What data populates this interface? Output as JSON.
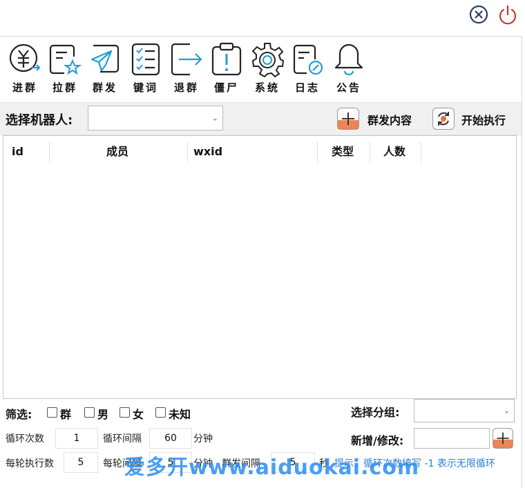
{
  "toolbar": {
    "items": [
      {
        "label": "进群",
        "icon": "yuan-group-icon"
      },
      {
        "label": "拉群",
        "icon": "document-star-icon"
      },
      {
        "label": "群发",
        "icon": "paper-plane-icon"
      },
      {
        "label": "键词",
        "icon": "checklist-icon"
      },
      {
        "label": "退群",
        "icon": "exit-arrow-icon"
      },
      {
        "label": "僵尸",
        "icon": "clipboard-alert-icon"
      },
      {
        "label": "系统",
        "icon": "gear-icon"
      },
      {
        "label": "日志",
        "icon": "document-edit-icon"
      },
      {
        "label": "公告",
        "icon": "bell-icon"
      }
    ]
  },
  "robot": {
    "label": "选择机器人:",
    "selected": "",
    "broadcast_label": "群发内容",
    "start_label": "开始执行"
  },
  "table": {
    "columns": [
      "id",
      "成员",
      "wxid",
      "类型",
      "人数"
    ],
    "rows": []
  },
  "filter": {
    "label": "筛选:",
    "options": [
      "群",
      "男",
      "女",
      "未知"
    ]
  },
  "group": {
    "select_label": "选择分组:",
    "selected": "",
    "add_label": "新增/修改:",
    "add_value": ""
  },
  "settings": {
    "loop_count_label": "循环次数",
    "loop_count": "1",
    "loop_interval_label": "循环间隔",
    "loop_interval": "60",
    "minute_unit": "分钟",
    "per_round_label": "每轮执行数",
    "per_round": "5",
    "round_interval_label": "每轮间隔",
    "round_interval": "5",
    "send_interval_label": "群发间隔",
    "send_interval": "5",
    "second_unit": "秒",
    "hint": "提示：循环次数填写 -1 表示无限循环"
  },
  "watermark": "爱多开www.aiduokai.com",
  "colors": {
    "accent": "#2a7fd4",
    "add_button": "#e8703a"
  }
}
